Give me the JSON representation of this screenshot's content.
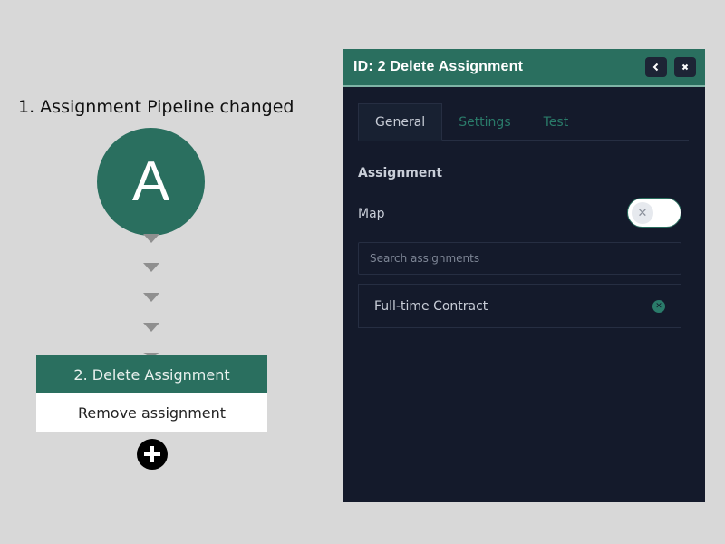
{
  "workflow": {
    "trigger": {
      "title": "1. Assignment Pipeline changed",
      "avatar_letter": "A"
    },
    "step": {
      "title": "2. Delete Assignment",
      "description": "Remove assignment"
    },
    "add_icon": "plus-icon"
  },
  "panel": {
    "title": "ID: 2  Delete Assignment",
    "collapse_icon": "chevron-left-icon",
    "close_icon": "close-icon",
    "tabs": [
      {
        "label": "General",
        "active": true
      },
      {
        "label": "Settings",
        "active": false
      },
      {
        "label": "Test",
        "active": false
      }
    ],
    "section_label": "Assignment",
    "map_label": "Map",
    "map_toggle": {
      "on": false,
      "icon": "x-icon"
    },
    "search": {
      "placeholder": "Search assignments",
      "value": ""
    },
    "selected": [
      {
        "label": "Full-time Contract",
        "remove_icon": "remove-circle-icon"
      }
    ]
  },
  "colors": {
    "accent": "#2a6f5f",
    "panel_bg": "#141a2b",
    "canvas_bg": "#d8d8d8"
  }
}
